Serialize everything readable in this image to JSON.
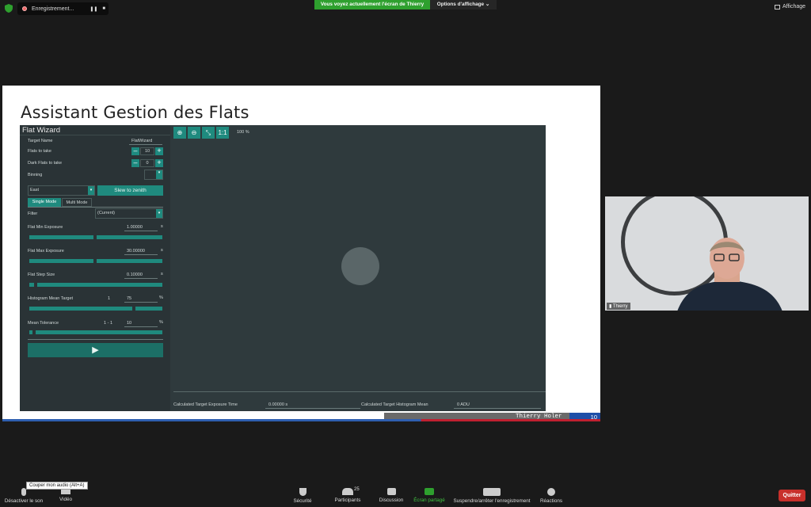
{
  "topbar": {
    "recording_label": "Enregistrement...",
    "share_banner": "Vous voyez actuellement l'écran de Thierry",
    "view_options": "Options d'affichage",
    "view_label": "Affichage"
  },
  "slide": {
    "title": "Assistant Gestion des Flats",
    "footer_name": "Thierry Holer",
    "footer_page": "10"
  },
  "app": {
    "window_title": "Flat Wizard",
    "target_name_label": "Target Name",
    "target_name_value": "FlatWizard",
    "flats_label": "Flats to take",
    "flats_value": "10",
    "dark_flats_label": "Dark Flats to take",
    "dark_flats_value": "0",
    "binning_label": "Binning",
    "direction_value": "East",
    "slew_button": "Slew to zenith",
    "tab_single": "Single Mode",
    "tab_multi": "Multi Mode",
    "filter_label": "Filter",
    "filter_value": "(Current)",
    "min_exp_label": "Flat Min Exposure",
    "min_exp_value": "1.00000",
    "min_exp_unit": "s",
    "max_exp_label": "Flat Max Exposure",
    "max_exp_value": "30.00000",
    "max_exp_unit": "s",
    "step_label": "Flat Step Size",
    "step_value": "0.10000",
    "step_unit": "s",
    "hist_label": "Histogram Mean Target",
    "hist_min": "1",
    "hist_value": "75",
    "hist_unit": "%",
    "tol_label": "Mean Tolerance",
    "tol_range": "1 - 1",
    "tol_value": "10",
    "tol_unit": "%",
    "zoom_one": "1:1",
    "zoom_pct": "100 %",
    "calc_exposure_label": "Calculated Target Exposure Time",
    "calc_exposure_value": "0.00000 s",
    "calc_hist_label": "Calculated Target Histogram Mean",
    "calc_hist_value": "0 ADU"
  },
  "webcam": {
    "name": "Thierry"
  },
  "bottombar": {
    "tooltip": "Couper mon audio (Alt+A)",
    "mute_label": "Désactiver le son",
    "video_label": "Vidéo",
    "security_label": "Sécurité",
    "participants_label": "Participants",
    "participants_count": "25",
    "chat_label": "Discussion",
    "share_label": "Écran partagé",
    "record_label": "Suspendre/arrêter l'enregistrement",
    "reactions_label": "Réactions",
    "quit_label": "Quitter"
  },
  "colors": {
    "accent": "#1f8a7e",
    "banner_green": "#2ea02e",
    "quit_red": "#c8302b"
  }
}
